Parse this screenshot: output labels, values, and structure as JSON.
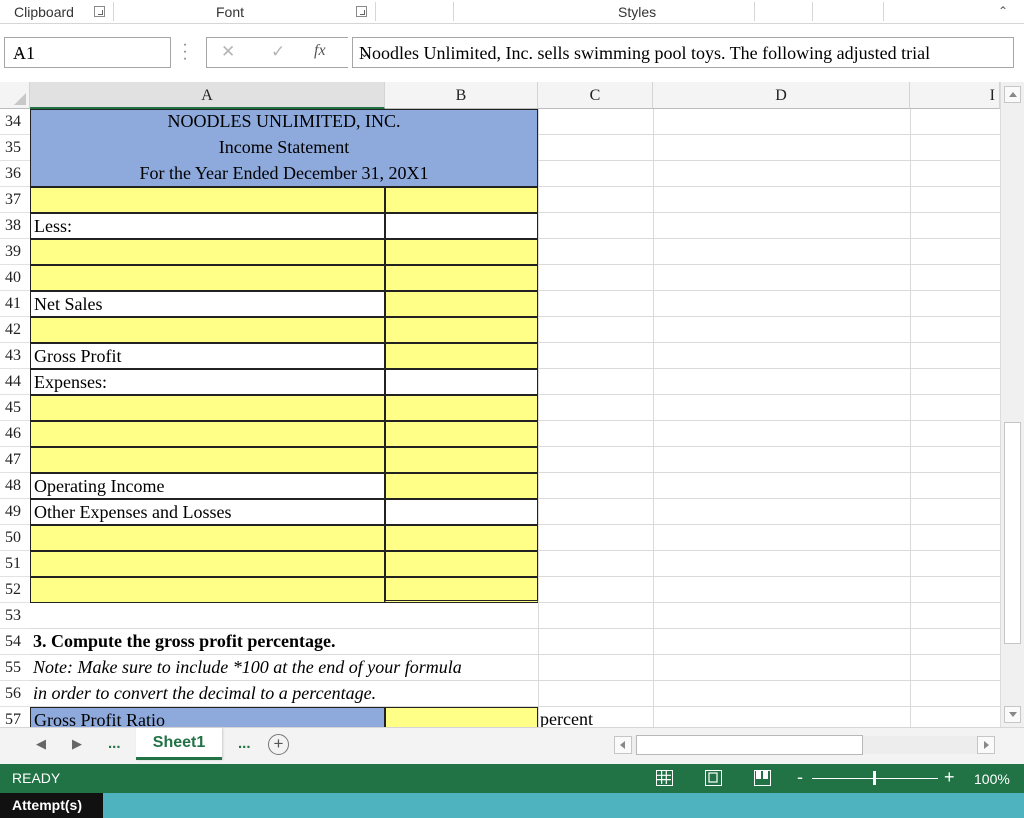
{
  "ribbon": {
    "groups": [
      {
        "label": "Clipboard",
        "has_launcher": true
      },
      {
        "label": "Font",
        "has_launcher": true
      },
      {
        "label": "Styles",
        "has_launcher": false
      }
    ],
    "collapse_icon": "chevron-up-icon"
  },
  "formula_bar": {
    "name_box": "A1",
    "cancel_icon": "close-icon",
    "enter_icon": "check-icon",
    "fx_label": "fx",
    "content": "Noodles Unlimited, Inc. sells swimming pool toys.  The following adjusted trial"
  },
  "grid": {
    "columns": [
      "A",
      "B",
      "C",
      "D",
      "I"
    ],
    "selected_column": "A",
    "rows": [
      {
        "num": "34",
        "A": "NOODLES UNLIMITED, INC.",
        "B": ""
      },
      {
        "num": "35",
        "A": "Income Statement",
        "B": ""
      },
      {
        "num": "36",
        "A": "For the Year Ended December 31, 20X1",
        "B": ""
      },
      {
        "num": "37",
        "A": "",
        "B": ""
      },
      {
        "num": "38",
        "A": "Less:",
        "B": ""
      },
      {
        "num": "39",
        "A": "",
        "B": ""
      },
      {
        "num": "40",
        "A": "",
        "B": ""
      },
      {
        "num": "41",
        "A": "Net Sales",
        "B": ""
      },
      {
        "num": "42",
        "A": "",
        "B": ""
      },
      {
        "num": "43",
        "A": "Gross Profit",
        "B": ""
      },
      {
        "num": "44",
        "A": "Expenses:",
        "B": ""
      },
      {
        "num": "45",
        "A": "",
        "B": ""
      },
      {
        "num": "46",
        "A": "",
        "B": ""
      },
      {
        "num": "47",
        "A": "",
        "B": ""
      },
      {
        "num": "48",
        "A": "Operating Income",
        "B": ""
      },
      {
        "num": "49",
        "A": "Other Expenses and Losses",
        "B": ""
      },
      {
        "num": "50",
        "A": "",
        "B": ""
      },
      {
        "num": "51",
        "A": "",
        "B": ""
      },
      {
        "num": "52",
        "A": "",
        "B": ""
      },
      {
        "num": "53",
        "A": "",
        "B": ""
      },
      {
        "num": "54",
        "A": "3. Compute the gross profit percentage.",
        "B": ""
      },
      {
        "num": "55",
        "A": "Note:  Make sure to include *100 at the end of your formula",
        "B": ""
      },
      {
        "num": "56",
        "A": "in order to convert the decimal to a percentage.",
        "B": ""
      },
      {
        "num": "57",
        "A": "Gross Profit Ratio",
        "B": "",
        "C": "percent"
      }
    ]
  },
  "sheet_tabs": {
    "active": "Sheet1",
    "ellipsis": "...",
    "add_icon": "plus-circle-icon"
  },
  "status_bar": {
    "mode": "READY",
    "zoom": "100%",
    "zoom_level_percent": 100
  },
  "attempts": {
    "label": "Attempt(s)"
  },
  "colors": {
    "excel_green": "#217346",
    "header_blue": "#8ea9db",
    "input_yellow": "#ffff88",
    "attempts_teal": "#4fb3bf"
  }
}
